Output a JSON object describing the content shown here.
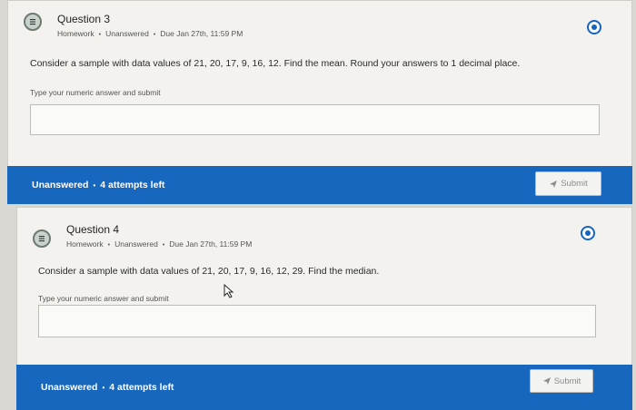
{
  "questions": [
    {
      "title": "Question 3",
      "meta": {
        "type": "Homework",
        "status": "Unanswered",
        "due": "Due Jan 27th, 11:59 PM"
      },
      "prompt": "Consider a sample with data values of 21, 20, 17, 9, 16, 12. Find the mean. Round your answers to 1 decimal place.",
      "hint": "Type your numeric answer and submit",
      "answer_value": "",
      "footer": {
        "status": "Unanswered",
        "attempts": "4 attempts left"
      },
      "submit_label": "Submit"
    },
    {
      "title": "Question 4",
      "meta": {
        "type": "Homework",
        "status": "Unanswered",
        "due": "Due Jan 27th, 11:59 PM"
      },
      "prompt": "Consider a sample with data values of 21, 20, 17, 9, 16, 12, 29. Find the median.",
      "hint": "Type your numeric answer and submit",
      "answer_value": "",
      "footer": {
        "status": "Unanswered",
        "attempts": "4 attempts left"
      },
      "submit_label": "Submit"
    }
  ],
  "icons": {
    "question": "list-icon",
    "status": "status-circle-icon",
    "submit": "send-icon",
    "cursor": "mouse-cursor-icon"
  },
  "colors": {
    "accent": "#1767bf",
    "card_bg": "#f3f2ee",
    "page_bg": "#d9d8d3"
  }
}
